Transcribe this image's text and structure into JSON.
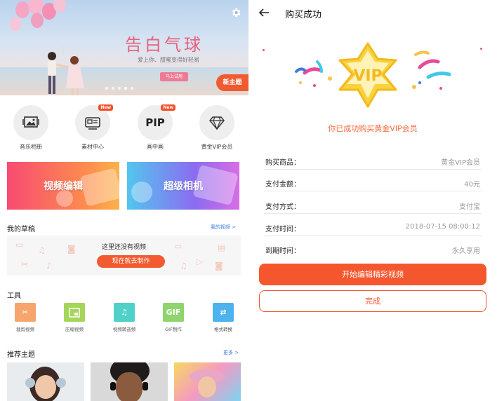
{
  "banner": {
    "title": "告白气球",
    "subtitle": "爱上你、甜蜜变得好轻易",
    "try_button": "马上试用",
    "new_theme_button": "新主题"
  },
  "features": [
    {
      "label": "音乐相册",
      "icon": "photo-music-icon"
    },
    {
      "label": "素材中心",
      "icon": "material-icon",
      "badge": "New"
    },
    {
      "label": "画中画",
      "icon": "pip-icon",
      "badge": "New",
      "icon_text": "PIP"
    },
    {
      "label": "黄金VIP会员",
      "icon": "diamond-icon"
    }
  ],
  "cards": {
    "video_edit": "视频编辑",
    "super_camera": "超级相机"
  },
  "drafts": {
    "title": "我的草稿",
    "link": "我的视频 >",
    "empty_message": "这里还没有视频",
    "make_button": "现在就去制作"
  },
  "tools": {
    "title": "工具",
    "items": [
      {
        "label": "裁剪视频",
        "icon": "scissors-icon",
        "color": "#f6a66c"
      },
      {
        "label": "压缩视频",
        "icon": "compress-icon",
        "color": "#a5d65a"
      },
      {
        "label": "视频转音频",
        "icon": "music-note-icon",
        "color": "#4fd1c9"
      },
      {
        "label": "GIF制作",
        "icon": "gif-icon",
        "icon_text": "GIF",
        "color": "#8fd46d"
      },
      {
        "label": "格式转换",
        "icon": "convert-icon",
        "color": "#4db3ee"
      }
    ]
  },
  "recommend": {
    "title": "推荐主题",
    "link": "更多 >"
  },
  "purchase": {
    "title": "购买成功",
    "vip_text": "VIP",
    "success_message": "你已成功购买黄金VIP会员",
    "rows": [
      {
        "label": "购买商品：",
        "value": "黄金VIP会员"
      },
      {
        "label": "支付金额：",
        "value": "40元"
      },
      {
        "label": "支付方式：",
        "value": "支付宝"
      },
      {
        "label": "支付时间：",
        "value": "2018-07-15 08:00:12"
      },
      {
        "label": "到期时间：",
        "value": "永久享用"
      }
    ],
    "start_button": "开始编辑精彩视频",
    "done_button": "完成"
  },
  "colors": {
    "accent": "#f4572e",
    "link": "#3b7ee4",
    "success_text": "#f26a3f"
  }
}
